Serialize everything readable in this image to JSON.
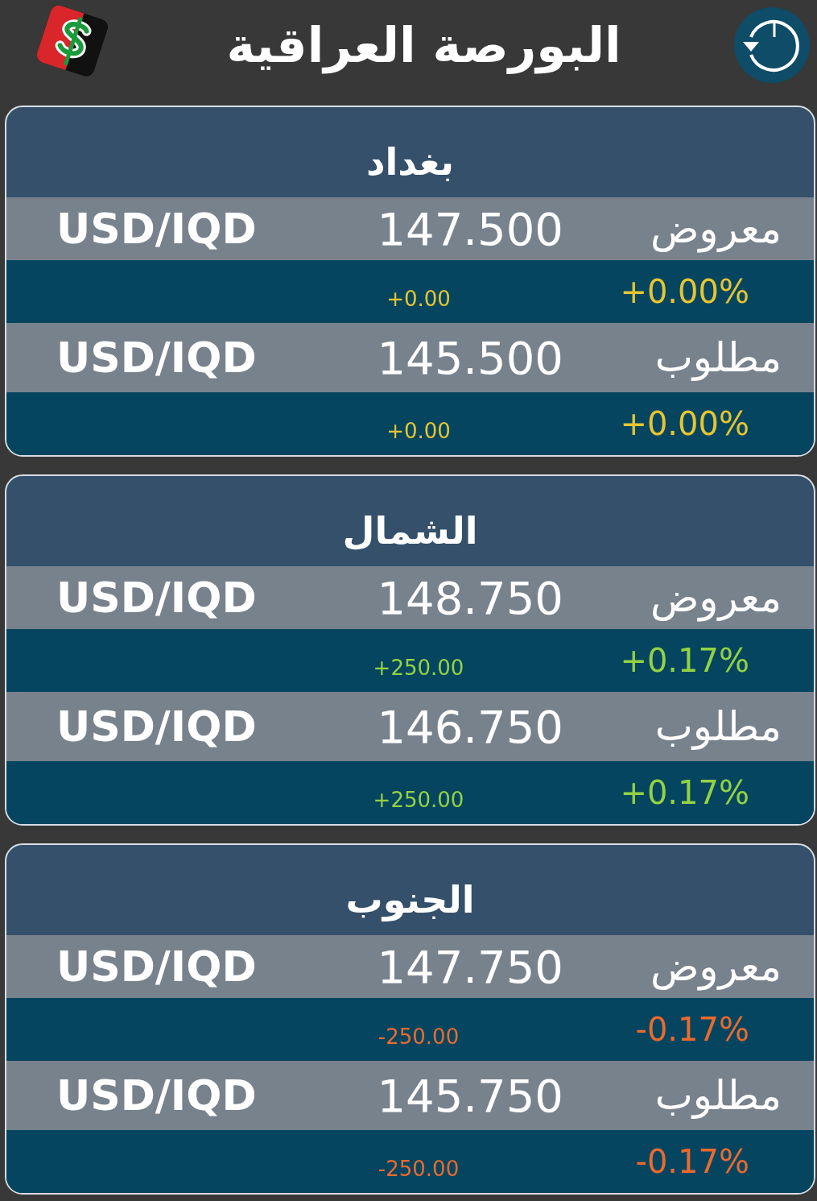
{
  "header": {
    "title": "البورصة العراقية"
  },
  "markets": [
    {
      "name": "بغداد",
      "quotes": [
        {
          "label": "معروض",
          "price": "147.500",
          "pair": "USD/IQD",
          "change_percent": "+0.00%",
          "change": "+0.00",
          "color": "#e6c531"
        },
        {
          "label": "مطلوب",
          "price": "145.500",
          "pair": "USD/IQD",
          "change_percent": "+0.00%",
          "change": "+0.00",
          "color": "#e6c531"
        }
      ]
    },
    {
      "name": "الشمال",
      "quotes": [
        {
          "label": "معروض",
          "price": "148.750",
          "pair": "USD/IQD",
          "change_percent": "+0.17%",
          "change": "+250.00",
          "color": "#93d243"
        },
        {
          "label": "مطلوب",
          "price": "146.750",
          "pair": "USD/IQD",
          "change_percent": "+0.17%",
          "change": "+250.00",
          "color": "#93d243"
        }
      ]
    },
    {
      "name": "الجنوب",
      "quotes": [
        {
          "label": "معروض",
          "price": "147.750",
          "pair": "USD/IQD",
          "change_percent": "-0.17%",
          "change": "-250.00",
          "color": "#ea6a2e"
        },
        {
          "label": "مطلوب",
          "price": "145.750",
          "pair": "USD/IQD",
          "change_percent": "-0.17%",
          "change": "-250.00",
          "color": "#ea6a2e"
        }
      ]
    }
  ]
}
